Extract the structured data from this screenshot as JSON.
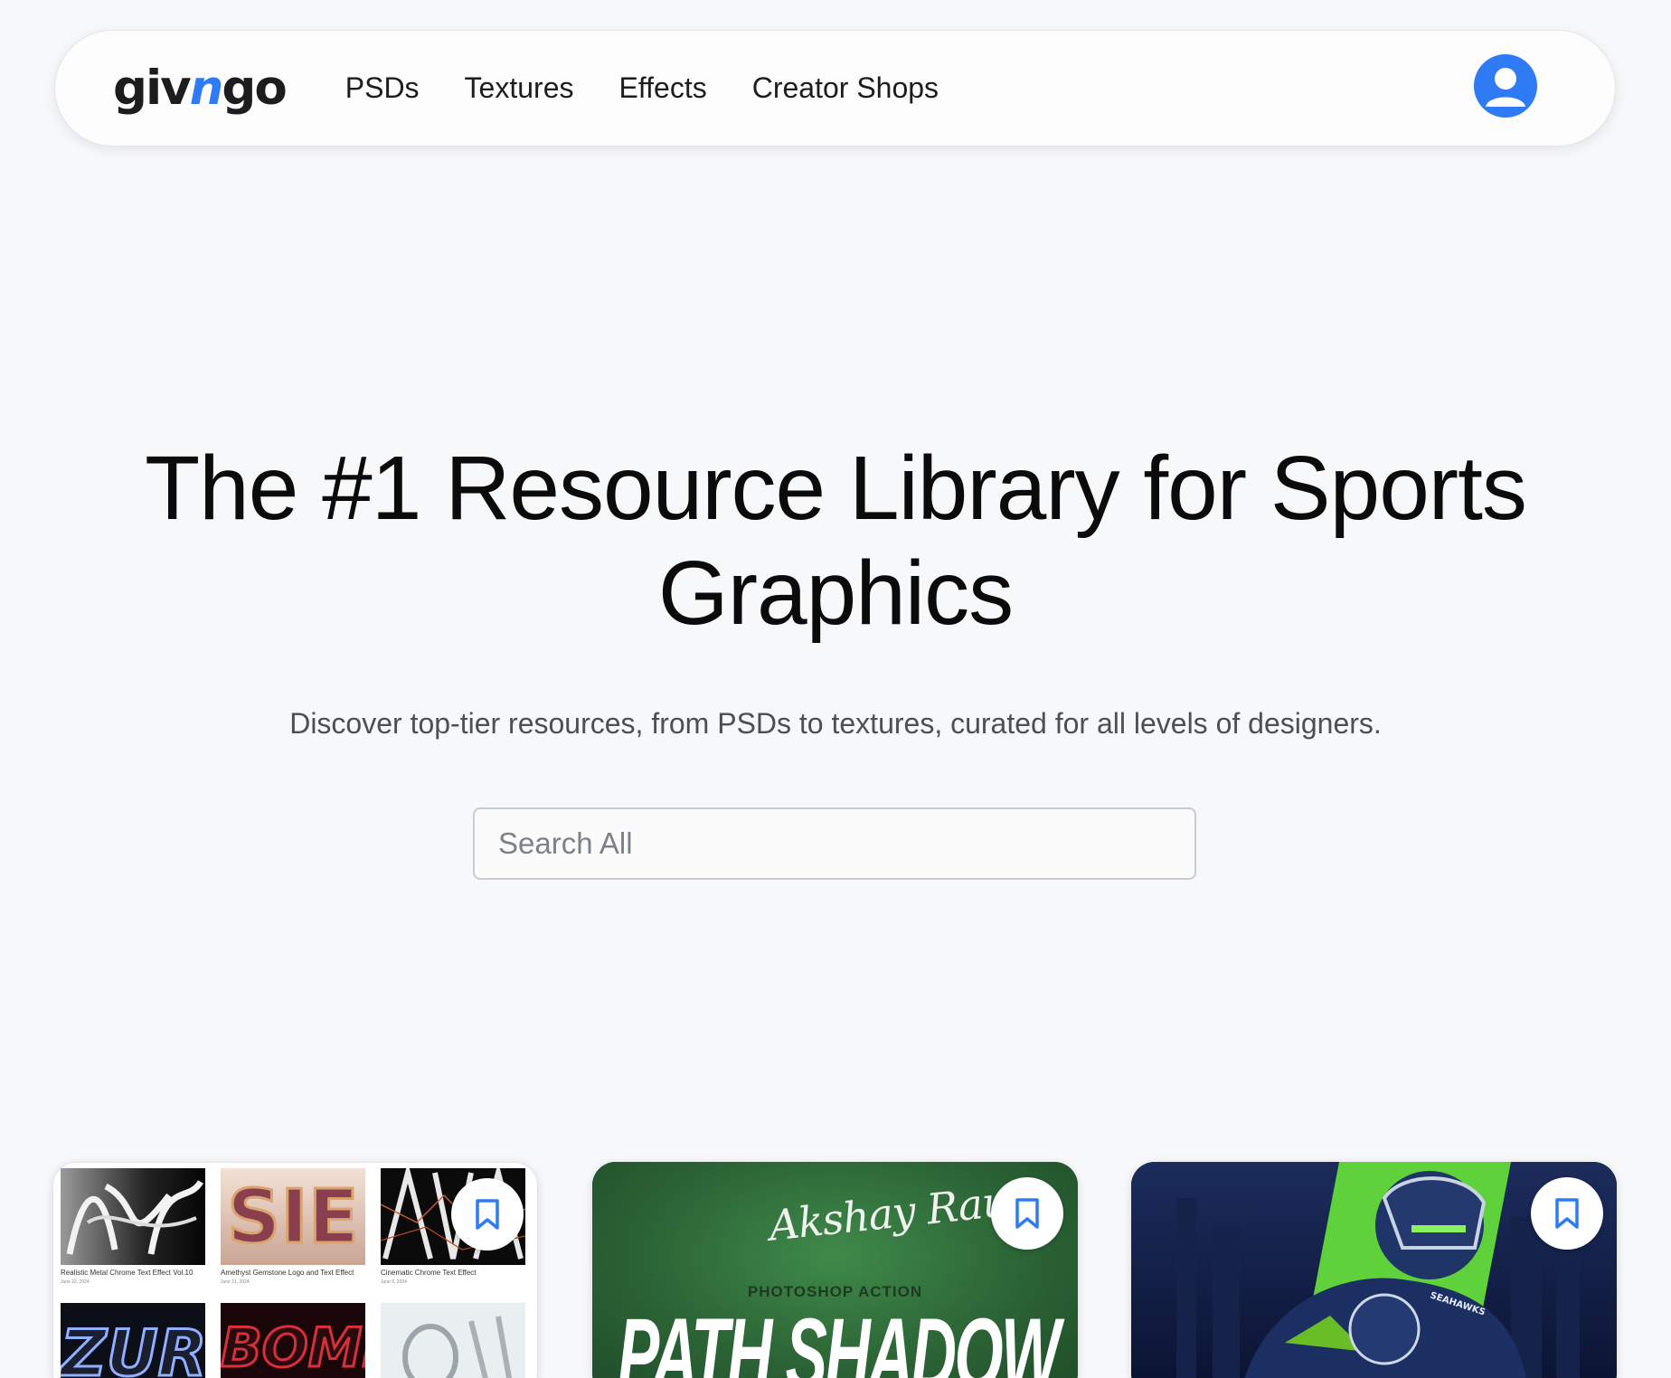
{
  "header": {
    "logo": {
      "part1": "giv",
      "part2": "n",
      "part3": "go"
    },
    "nav": [
      {
        "label": "PSDs"
      },
      {
        "label": "Textures"
      },
      {
        "label": "Effects"
      },
      {
        "label": "Creator Shops"
      }
    ],
    "avatar_icon": "user-avatar-icon"
  },
  "hero": {
    "title_line1": "The #1 Resource Library for Sports",
    "title_line2": "Graphics",
    "subtitle": "Discover top-tier resources, from PSDs to textures, curated for all levels of designers.",
    "search_placeholder": "Search All"
  },
  "cards": [
    {
      "thumbs": [
        {
          "caption": "Realistic Metal Chrome Text Effect Vol.10",
          "date": "June 22, 2024"
        },
        {
          "caption": "Amethyst Gemstone Logo and Text Effect",
          "date": "June 21, 2024"
        },
        {
          "caption": "Cinematic Chrome Text Effect",
          "date": "June 6, 2024"
        }
      ]
    },
    {
      "signature": "Akshay Rau",
      "kicker": "PHOTOSHOP ACTION",
      "headline": "PATH SHADOW"
    },
    {
      "team_text": "SEAHAWKS"
    }
  ],
  "colors": {
    "accent": "#2f7bf5",
    "background": "#f7f8fa",
    "card2_green": "#2f6a3a",
    "card3_navy": "#101a3c"
  },
  "icons": [
    "user-avatar-icon",
    "bookmark-icon"
  ]
}
